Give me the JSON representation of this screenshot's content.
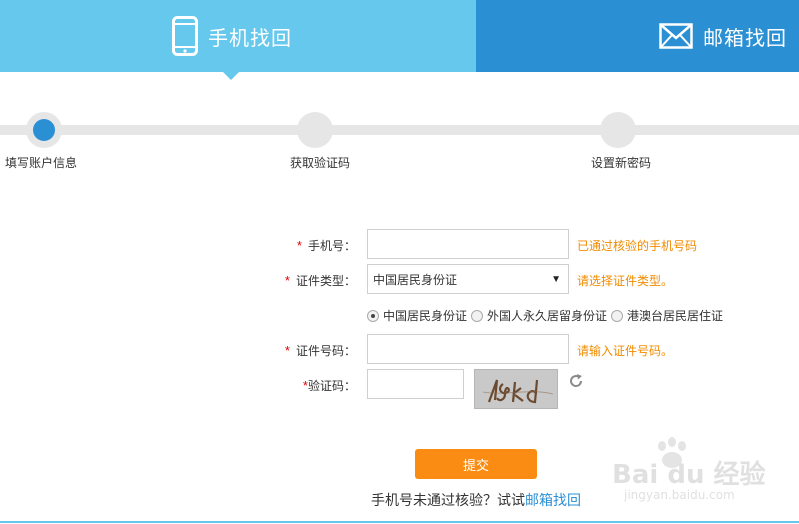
{
  "tabs": {
    "phone_label": "手机找回",
    "email_label": "邮箱找回"
  },
  "steps": [
    {
      "label": "填写账户信息"
    },
    {
      "label": "获取验证码"
    },
    {
      "label": "设置新密码"
    }
  ],
  "form": {
    "required_mark": "*",
    "phone": {
      "label": "手机号：",
      "value": "",
      "hint": "已通过核验的手机号码"
    },
    "id_type": {
      "label": "证件类型：",
      "selected": "中国居民身份证",
      "hint": "请选择证件类型。"
    },
    "id_options": [
      "中国居民身份证",
      "外国人永久居留身份证",
      "港澳台居民居住证"
    ],
    "id_number": {
      "label": "证件号码：",
      "value": "",
      "hint": "请输入证件号码。"
    },
    "captcha": {
      "label": "验证码：",
      "value": "",
      "image_text": "fkd"
    },
    "submit_label": "提交",
    "alt_prefix": "手机号未通过核验？试试",
    "alt_link": "邮箱找回"
  },
  "watermark": {
    "brand": "Bai du 经验",
    "url": "jingyan.baidu.com"
  },
  "colors": {
    "tab_active": "#66c8ec",
    "tab_inactive": "#2b8fd4",
    "accent_orange": "#fa8c14",
    "hint_orange": "#f08c00",
    "required_red": "#e60000"
  }
}
